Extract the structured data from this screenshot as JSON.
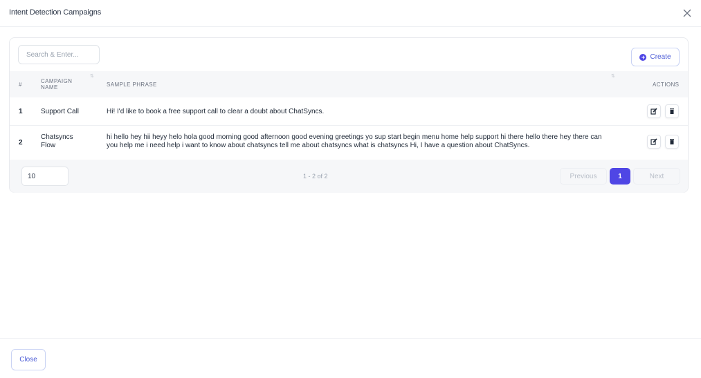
{
  "modal": {
    "title": "Intent Detection Campaigns",
    "close_icon": "close-x-icon",
    "footer_close_label": "Close"
  },
  "toolbar": {
    "search_placeholder": "Search & Enter...",
    "create_label": "Create",
    "create_icon": "plus-circle-icon"
  },
  "table": {
    "headers": {
      "index": "#",
      "campaign_name": "CAMPAIGN NAME",
      "sample_phrase": "SAMPLE PHRASE",
      "actions": "ACTIONS"
    },
    "rows": [
      {
        "num": "1",
        "name": "Support Call",
        "phrase": "Hi! I'd like to book a free support call to clear a doubt about ChatSyncs."
      },
      {
        "num": "2",
        "name": "Chatsyncs Flow",
        "phrase": "hi hello hey hii heyy helo hola good morning good afternoon good evening greetings yo sup start begin menu home help support hi there hello there hey there can you help me i need help i want to know about chatsyncs tell me about chatsyncs what is chatsyncs Hi, I have a question about ChatSyncs."
      }
    ]
  },
  "pagination": {
    "page_size": "10",
    "range_text": "1 - 2 of 2",
    "previous_label": "Previous",
    "current_page": "1",
    "next_label": "Next"
  },
  "colors": {
    "accent": "#4f46e5",
    "header_bg": "#f6f7f9"
  }
}
